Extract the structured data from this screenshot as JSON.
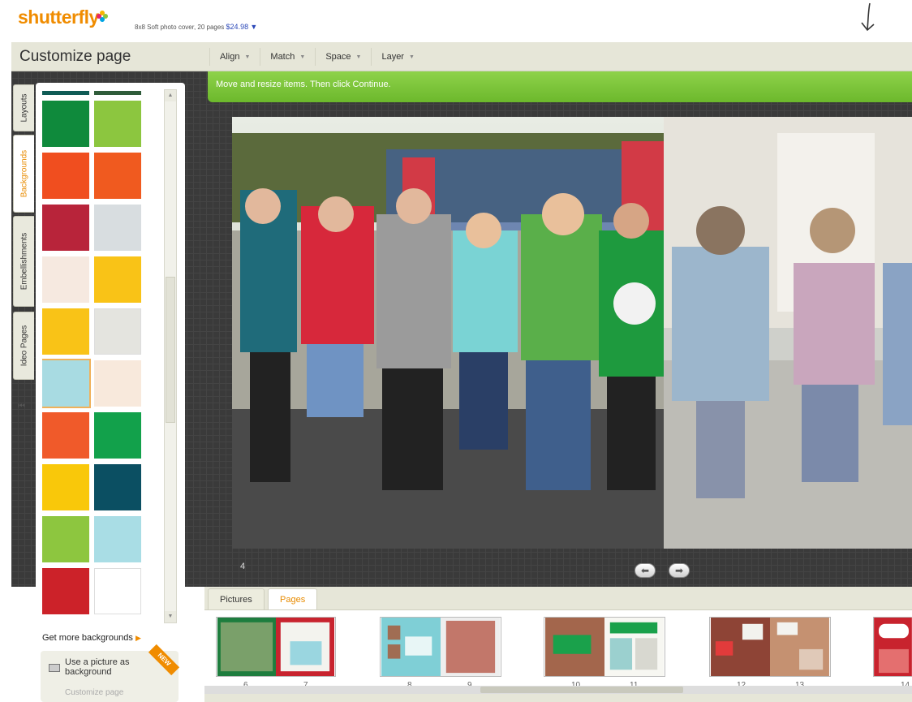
{
  "header": {
    "logo": "shutterfly",
    "product_desc": "8x8 Soft photo cover, 20 pages",
    "price": "$24.98"
  },
  "toolbar": {
    "title": "Customize page",
    "tools": [
      "Align",
      "Match",
      "Space",
      "Layer"
    ]
  },
  "instruction": "Move and resize items. Then click Continue.",
  "side_tabs": [
    "Layouts",
    "Backgrounds",
    "Embellishments",
    "Ideo Pages"
  ],
  "panel": {
    "swatches": [
      {
        "colors": [
          "#0f5b55",
          "#2f5c3a"
        ]
      },
      {
        "colors": [
          "#0f8a3c",
          "#8cc63f"
        ]
      },
      {
        "colors": [
          "#f04e1f",
          "#f05a1f"
        ]
      },
      {
        "colors": [
          "#b8243a",
          "#d8dde0"
        ]
      },
      {
        "colors": [
          "#f6e9e0",
          "#f9c317"
        ]
      },
      {
        "colors": [
          "#f9c317",
          "#e4e4df"
        ]
      },
      {
        "colors": [
          "#a8dbe2",
          "#f8e9dc"
        ]
      },
      {
        "colors": [
          "#f05a2a",
          "#12a14b"
        ]
      },
      {
        "colors": [
          "#f9c80a",
          "#0b4f62"
        ]
      },
      {
        "colors": [
          "#8dc63f",
          "#a9dde5"
        ]
      },
      {
        "colors": [
          "#cc2229",
          "#ffffff"
        ]
      }
    ],
    "get_more": "Get more backgrounds",
    "use_picture": "Use a picture as background",
    "customize": "Customize page",
    "new_badge": "NEW"
  },
  "canvas": {
    "page_number": "4"
  },
  "tray": {
    "tabs": [
      "Pictures",
      "Pages"
    ],
    "active_tab": "Pages",
    "page_labels": [
      "6",
      "7",
      "8",
      "9",
      "10",
      "11",
      "12",
      "13",
      "14"
    ]
  },
  "colors": {
    "accent": "#f08c00",
    "instruction_green": "#7cc43a",
    "stage": "#3a3a3a"
  }
}
